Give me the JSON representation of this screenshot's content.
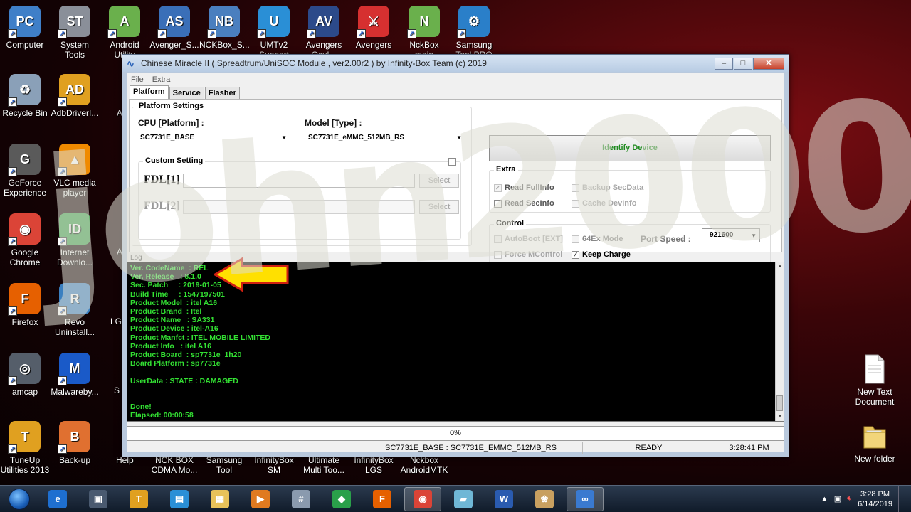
{
  "desktop_icons_left": [
    {
      "label": "Computer",
      "color": "#3f7fc8",
      "glyph": "PC"
    },
    {
      "label": "System Tools",
      "color": "#8a8f99",
      "glyph": "ST"
    },
    {
      "label": "Android\nUtility",
      "color": "#6ab04c",
      "glyph": "A"
    },
    {
      "label": "Avenger_S...",
      "color": "#3a6fb8",
      "glyph": "AS"
    },
    {
      "label": "NCKBox_S...",
      "color": "#4a7fbf",
      "glyph": "NB"
    },
    {
      "label": "UMTv2\nSupport",
      "color": "#2a8fd6",
      "glyph": "U"
    },
    {
      "label": "Avengers\nOcul...",
      "color": "#2c4a8a",
      "glyph": "AV"
    },
    {
      "label": "Avengers",
      "color": "#d63030",
      "glyph": "⚔"
    },
    {
      "label": "NckBox main",
      "color": "#6ab04c",
      "glyph": "N"
    },
    {
      "label": "Samsung\nTool PRO",
      "color": "#2a7fc9",
      "glyph": "⚙"
    }
  ],
  "desktop_icons_col1": [
    {
      "label": "Recycle Bin",
      "color": "#8aa0b8",
      "glyph": "♻"
    },
    {
      "label": "GeForce\nExperience",
      "color": "#5a5a5a",
      "glyph": "G"
    },
    {
      "label": "Google\nChrome",
      "color": "#db4437",
      "glyph": "◉"
    },
    {
      "label": "Firefox",
      "color": "#e66000",
      "glyph": "F"
    },
    {
      "label": "amcap",
      "color": "#555e6a",
      "glyph": "◎"
    },
    {
      "label": "TuneUp\nUtilities 2013",
      "color": "#e0a020",
      "glyph": "T"
    }
  ],
  "desktop_icons_col2": [
    {
      "label": "AdbDriverI...",
      "color": "#e0a020",
      "glyph": "AD"
    },
    {
      "label": "VLC media\nplayer",
      "color": "#f08a00",
      "glyph": "▲"
    },
    {
      "label": "Internet\nDownlo...",
      "color": "#3aa04a",
      "glyph": "ID"
    },
    {
      "label": "Revo\nUninstall...",
      "color": "#3a7fc0",
      "glyph": "R"
    },
    {
      "label": "Malwareby...",
      "color": "#1a5ac8",
      "glyph": "M"
    },
    {
      "label": "Back-up",
      "color": "#e07030",
      "glyph": "B"
    }
  ],
  "desktop_icons_col3_partial": [
    "A",
    "A",
    "LG",
    "S",
    "Help"
  ],
  "desktop_bottom_labels": [
    "NCK BOX\nCDMA Mo...",
    "Samsung\nTool",
    "InfinityBox\nSM",
    "Ultimate\nMulti Too...",
    "InfinityBox\nLGS",
    "Nckbox\nAndroidMTK"
  ],
  "right_icons": [
    {
      "label": "New Text\nDocument"
    },
    {
      "label": "New folder"
    }
  ],
  "window": {
    "title": "Chinese Miracle II ( Spreadtrum/UniSOC Module , ver2.00r2 ) by Infinity-Box Team (c) 2019",
    "buttons": {
      "minimize": "–",
      "maximize": "□",
      "close": "✕"
    },
    "menu": [
      "File",
      "Extra"
    ],
    "tabs": [
      "Platform",
      "Service",
      "Flasher"
    ],
    "platform_settings": {
      "title": "Platform Settings",
      "cpu_label": "CPU [Platform] :",
      "cpu_value": "SC7731E_BASE",
      "model_label": "Model [Type] :",
      "model_value": "SC7731E_eMMC_512MB_RS"
    },
    "custom_setting": {
      "title": "Custom Setting",
      "fdl1_label": "FDL[1]",
      "fdl2_label": "FDL[2]",
      "select_label": "Select"
    },
    "identify_button": "Identify Device",
    "extra": {
      "title": "Extra",
      "read_fullinfo": "Read FullInfo",
      "backup_secdata": "Backup SecData",
      "read_secinfo": "Read SecInfo",
      "cache_devinfo": "Cache DevInfo"
    },
    "control": {
      "title": "Control",
      "autoboot": "AutoBoot [EXT]",
      "mode_64ex": "64Ex Mode",
      "port_speed_label": "Port Speed :",
      "port_speed_value": "921600",
      "force_mcontrol": "Force MControl",
      "keep_charge": "Keep Charge"
    },
    "log_label": "Log",
    "log_lines": [
      "Ver. CodeName  : REL",
      "Ver. Release   : 8.1.0",
      "Sec. Patch     : 2019-01-05",
      "Build Time     : 1547197501",
      "Product Model  : itel A16",
      "Product Brand  : Itel",
      "Product Name   : SA331",
      "Product Device : itel-A16",
      "Product Manfct : ITEL MOBILE LIMITED",
      "Product Info   : itel A16",
      "Product Board  : sp7731e_1h20",
      "Board Platform : sp7731e",
      "",
      "UserData : STATE : DAMAGED",
      "",
      "",
      "Done!",
      "Elapsed: 00:00:58"
    ],
    "progress_text": "0%",
    "progress_value": 0,
    "status": {
      "platform": "SC7731E_BASE : SC7731E_EMMC_512MB_RS",
      "state": "READY",
      "time": "3:28:41 PM"
    }
  },
  "watermark": "john2000",
  "taskbar": {
    "items": [
      {
        "name": "internet-explorer",
        "color": "#1e6fd0",
        "glyph": "e"
      },
      {
        "name": "app-2",
        "color": "#4a5a70",
        "glyph": "▣"
      },
      {
        "name": "tuneup",
        "color": "#e0a020",
        "glyph": "T"
      },
      {
        "name": "toolbox",
        "color": "#2a8fd6",
        "glyph": "▤"
      },
      {
        "name": "explorer",
        "color": "#e8c25a",
        "glyph": "▦"
      },
      {
        "name": "media",
        "color": "#e07a20",
        "glyph": "▶"
      },
      {
        "name": "calculator",
        "color": "#8a9aae",
        "glyph": "#"
      },
      {
        "name": "network",
        "color": "#2aa04a",
        "glyph": "◆"
      },
      {
        "name": "firefox",
        "color": "#e66000",
        "glyph": "F"
      },
      {
        "name": "chrome",
        "color": "#db4437",
        "glyph": "◉"
      },
      {
        "name": "notes",
        "color": "#6fb7d6",
        "glyph": "▰"
      },
      {
        "name": "word",
        "color": "#2a5bb0",
        "glyph": "W"
      },
      {
        "name": "paint",
        "color": "#c8a060",
        "glyph": "❀"
      },
      {
        "name": "infinity",
        "color": "#3a7ad0",
        "glyph": "∞"
      }
    ],
    "clock_time": "3:28 PM",
    "clock_date": "6/14/2019"
  }
}
